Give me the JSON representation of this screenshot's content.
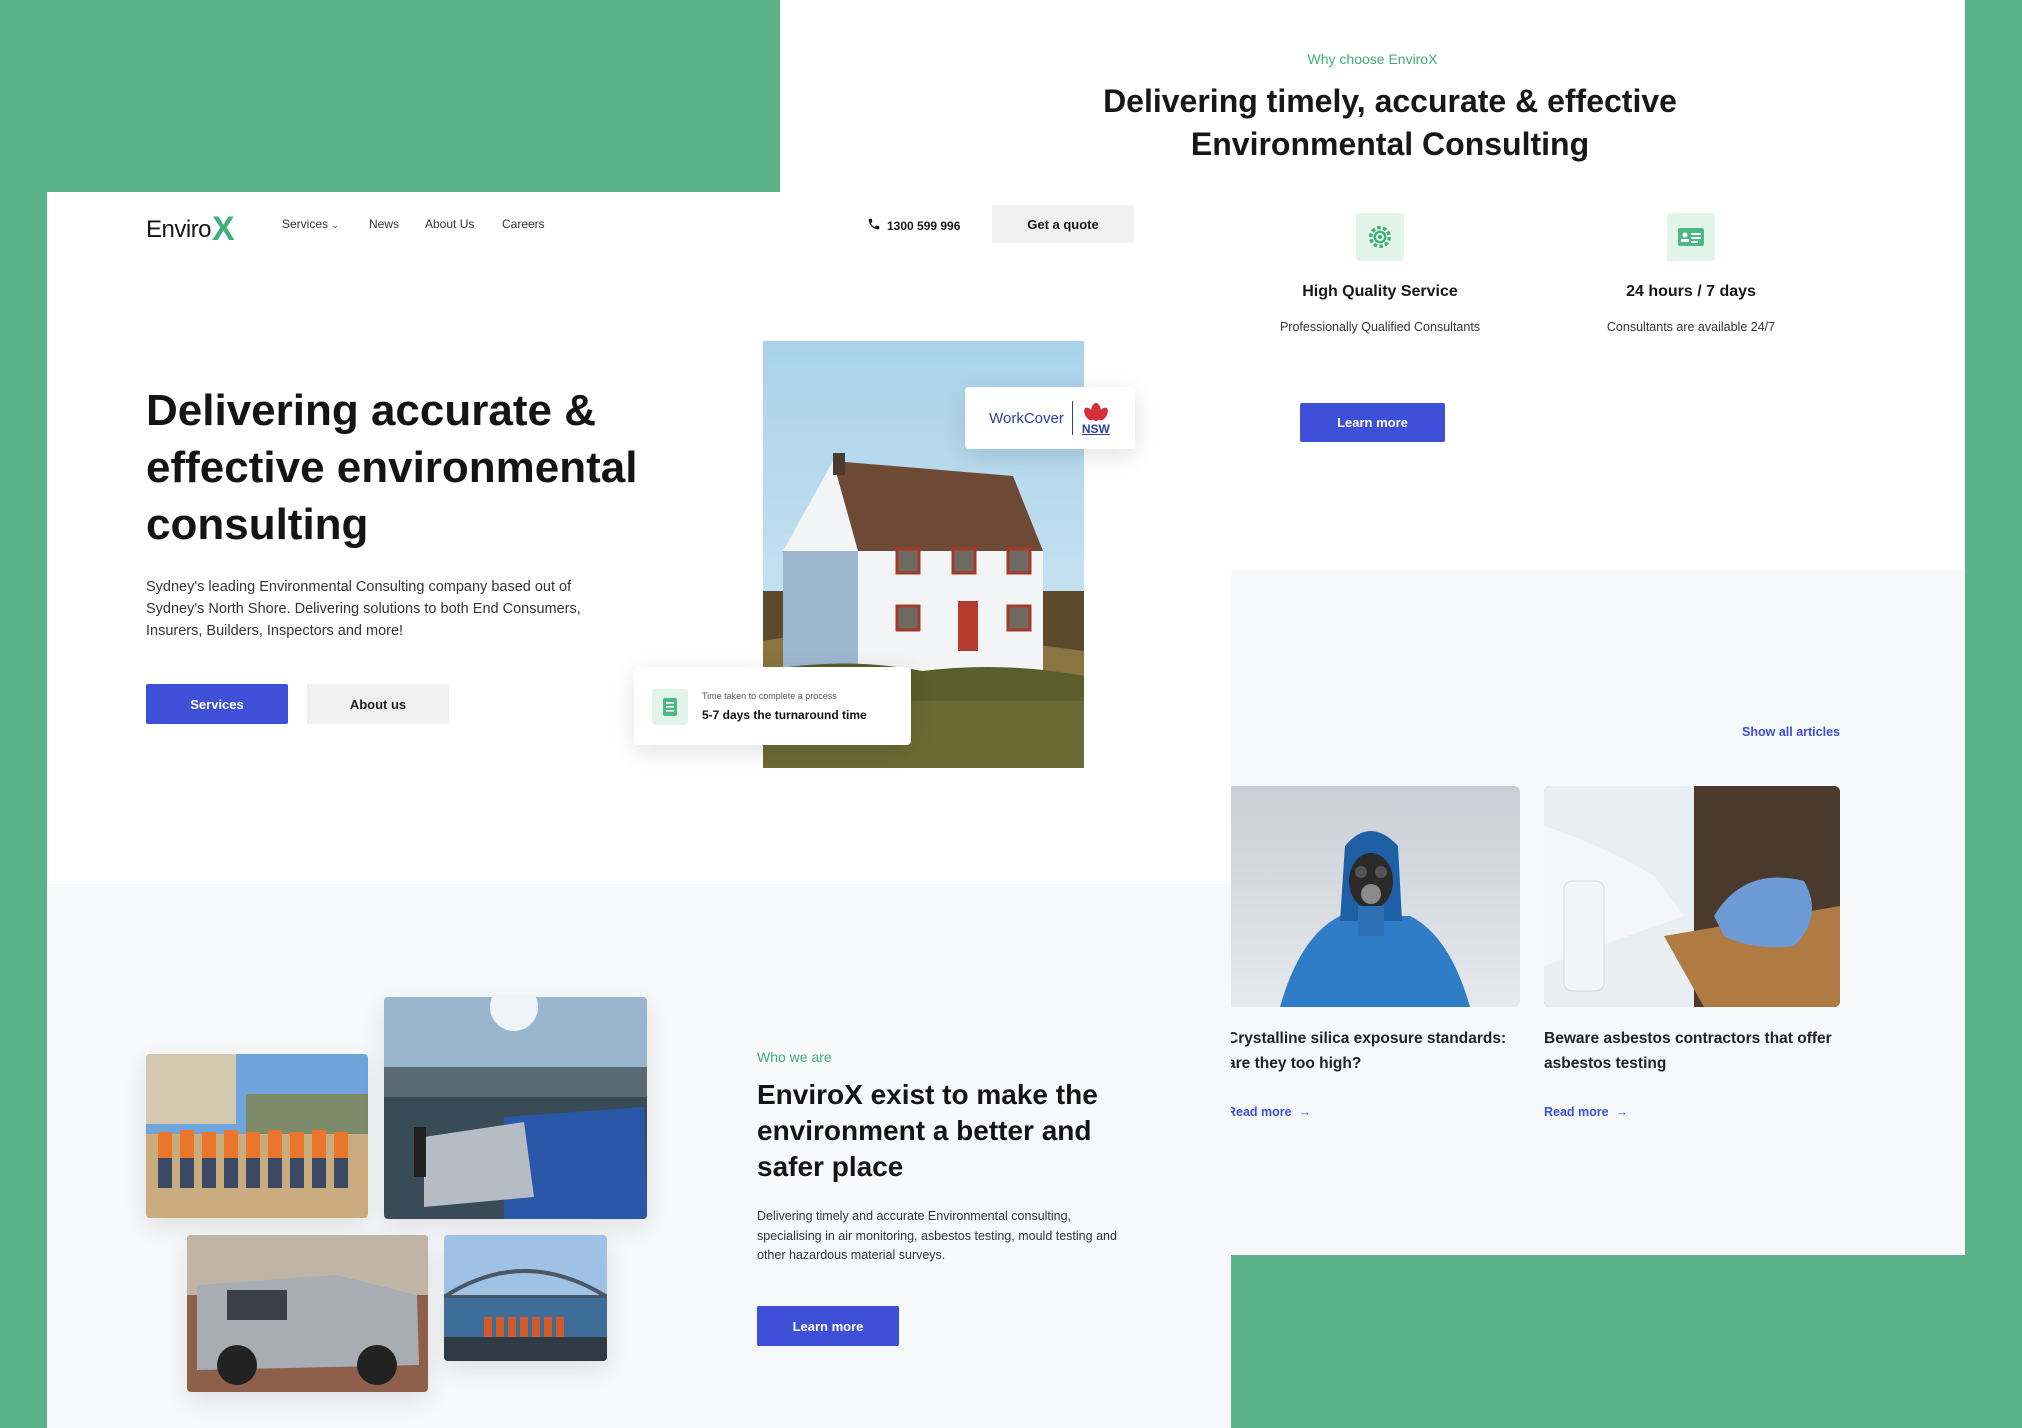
{
  "back": {
    "eyebrow": "Why choose EnviroX",
    "title": "Delivering timely, accurate & effective Environmental Consulting",
    "features": [
      {
        "icon": "gear-icon",
        "title": "High Quality Service",
        "desc": "Professionally Qualified Consultants"
      },
      {
        "icon": "id-card-icon",
        "title": "24 hours / 7 days",
        "desc": "Consultants are available 24/7"
      }
    ],
    "learn_more": "Learn more",
    "show_all": "Show all articles",
    "articles": [
      {
        "title": "Crystalline silica exposure standards: are they too high?",
        "read_more": "Read more"
      },
      {
        "title": "Beware asbestos contractors that offer asbestos testing",
        "read_more": "Read more"
      }
    ]
  },
  "front": {
    "logo": {
      "text": "Enviro",
      "mark": "X"
    },
    "nav": {
      "services": "Services",
      "news": "News",
      "about": "About Us",
      "careers": "Careers"
    },
    "phone": "1300 599 996",
    "quote_button": "Get a quote",
    "hero": {
      "title": "Delivering accurate & effective environmental consulting",
      "desc": "Sydney's leading Environmental Consulting company based out of Sydney's North Shore. Delivering solutions to both End Consumers, Insurers, Builders, Inspectors and more!",
      "services_button": "Services",
      "about_button": "About us"
    },
    "workcover": {
      "text": "WorkCover",
      "nsw": "NSW"
    },
    "turnaround": {
      "label": "Time taken to complete a process",
      "value": "5-7 days the turnaround time"
    },
    "who": {
      "eyebrow": "Who we are",
      "title": "EnviroX exist to make the environment a better and safer place",
      "desc": "Delivering timely and accurate Environmental consulting, specialising in air monitoring, asbestos testing, mould testing and other hazardous material surveys.",
      "learn_more": "Learn more"
    }
  },
  "colors": {
    "background": "#5bb287",
    "accent_green": "#3fae78",
    "brand_blue": "#3e4fd8"
  }
}
